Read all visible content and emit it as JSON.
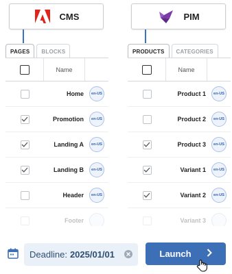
{
  "cms": {
    "title": "CMS",
    "logo_icon": "adobe-logo-icon",
    "tabs": [
      {
        "label": "PAGES",
        "active": true
      },
      {
        "label": "BLOCKS",
        "active": false
      }
    ],
    "header": {
      "name": "Name"
    },
    "rows": [
      {
        "name": "Home",
        "checked": false,
        "locale": "en-US",
        "faded": false
      },
      {
        "name": "Promotion",
        "checked": true,
        "locale": "en-US",
        "faded": false
      },
      {
        "name": "Landing A",
        "checked": true,
        "locale": "en-US",
        "faded": false
      },
      {
        "name": "Landing B",
        "checked": true,
        "locale": "en-US",
        "faded": false
      },
      {
        "name": "Header",
        "checked": false,
        "locale": "en-US",
        "faded": false
      },
      {
        "name": "Footer",
        "checked": false,
        "locale": "",
        "faded": true
      }
    ]
  },
  "pim": {
    "title": "PIM",
    "logo_icon": "akeneo-logo-icon",
    "tabs": [
      {
        "label": "PRODUCTS",
        "active": true
      },
      {
        "label": "CATEGORIES",
        "active": false
      }
    ],
    "header": {
      "name": "Name"
    },
    "rows": [
      {
        "name": "Product 1",
        "checked": false,
        "locale": "en-US",
        "faded": false
      },
      {
        "name": "Product 2",
        "checked": false,
        "locale": "en-US",
        "faded": false
      },
      {
        "name": "Product 3",
        "checked": true,
        "locale": "en-US",
        "faded": false
      },
      {
        "name": "Variant 1",
        "checked": true,
        "locale": "en-US",
        "faded": false
      },
      {
        "name": "Variant 2",
        "checked": true,
        "locale": "en-US",
        "faded": false
      },
      {
        "name": "Variant 3",
        "checked": false,
        "locale": "",
        "faded": true
      }
    ]
  },
  "footer": {
    "deadline_label": "Deadline:",
    "deadline_value": "2025/01/01",
    "launch_label": "Launch",
    "icons": [
      "calendar-icon",
      "clear-icon",
      "chevron-right-icon",
      "hand-cursor-icon"
    ]
  },
  "colors": {
    "accent": "#3d6fb6",
    "adobe_red": "#e2231a",
    "akeneo_purple": "#7c3ca8",
    "chip_bg": "#eaf0f7"
  }
}
